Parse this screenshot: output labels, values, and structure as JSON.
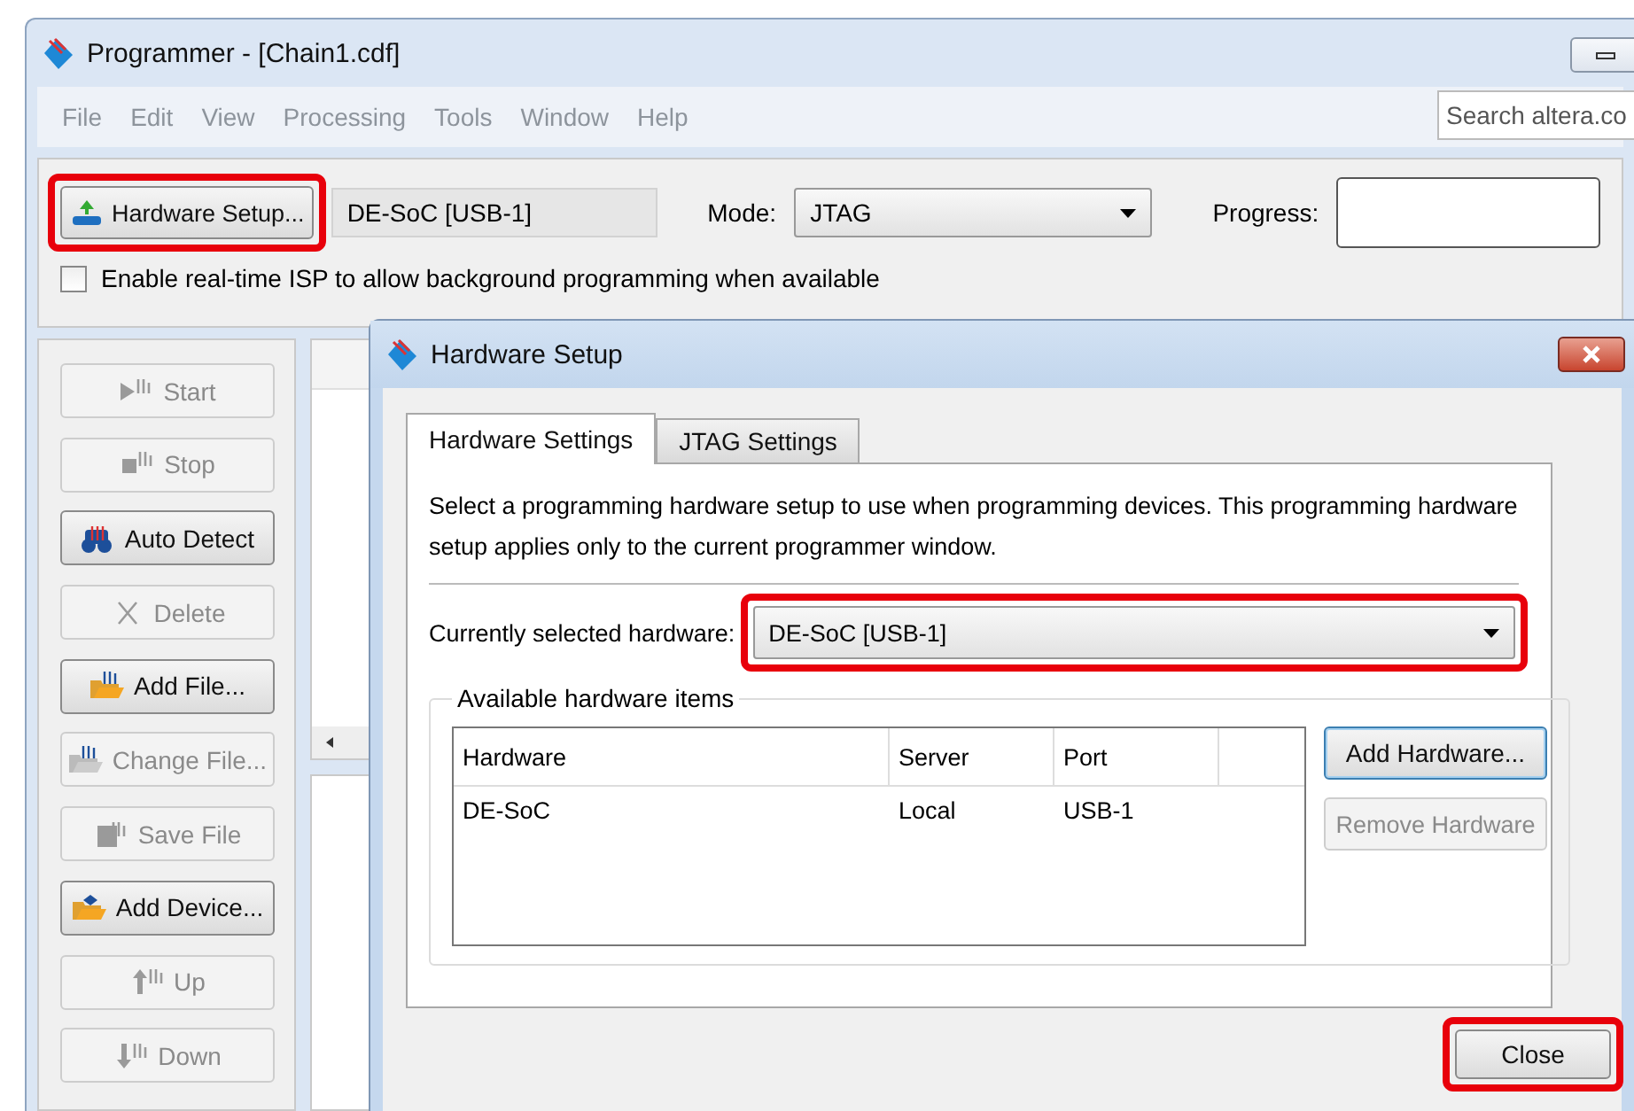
{
  "window": {
    "title": "Programmer - [Chain1.cdf]"
  },
  "menu": [
    "File",
    "Edit",
    "View",
    "Processing",
    "Tools",
    "Window",
    "Help"
  ],
  "search": {
    "placeholder": "Search altera.co"
  },
  "toolbar": {
    "hardware_button": {
      "label": "Hardware Setup...",
      "highlighted": true
    },
    "hardware_value": "DE-SoC [USB-1]",
    "mode_label": "Mode:",
    "mode": "JTAG",
    "progress_label": "Progress:"
  },
  "isp": {
    "label": "Enable real-time ISP to allow background programming when available",
    "checked": false
  },
  "side_buttons": [
    {
      "kind": "start",
      "label": "Start",
      "disabled": true
    },
    {
      "kind": "stop",
      "label": "Stop",
      "disabled": true
    },
    {
      "kind": "detect",
      "label": "Auto Detect",
      "disabled": false
    },
    {
      "kind": "delete",
      "label": "Delete",
      "disabled": true
    },
    {
      "kind": "add-file",
      "label": "Add File...",
      "disabled": false
    },
    {
      "kind": "change-file",
      "label": "Change File...",
      "disabled": true
    },
    {
      "kind": "save",
      "label": "Save File",
      "disabled": true
    },
    {
      "kind": "add-device",
      "label": "Add Device...",
      "disabled": false
    },
    {
      "kind": "up",
      "label": "Up",
      "disabled": true
    },
    {
      "kind": "down",
      "label": "Down",
      "disabled": true
    }
  ],
  "dialog": {
    "title": "Hardware Setup",
    "tabs": [
      {
        "label": "Hardware Settings",
        "selected": true
      },
      {
        "label": "JTAG Settings",
        "selected": false
      }
    ],
    "description": "Select a programming hardware setup to use when programming devices. This programming hardware setup applies only to the current programmer window.",
    "current_label": "Currently selected hardware:",
    "current": {
      "value": "DE-SoC [USB-1]",
      "highlighted": true
    },
    "group_title": "Available hardware items",
    "table": {
      "columns": [
        "Hardware",
        "Server",
        "Port"
      ],
      "rows": [
        [
          "DE-SoC",
          "Local",
          "USB-1"
        ]
      ]
    },
    "buttons": [
      {
        "label": "Add Hardware...",
        "disabled": false
      },
      {
        "label": "Remove Hardware",
        "disabled": true
      }
    ],
    "close": {
      "label": "Close",
      "highlighted": true
    }
  }
}
